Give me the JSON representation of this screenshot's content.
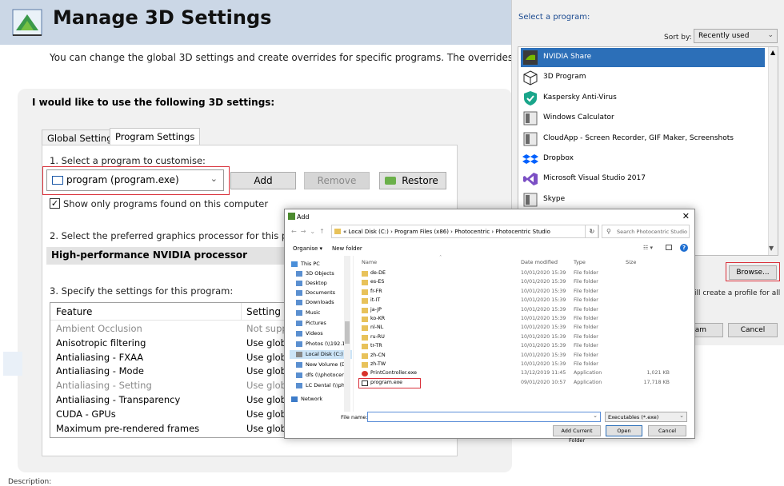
{
  "header": {
    "title": "Manage 3D Settings"
  },
  "intro": "You can change the global 3D settings and create overrides for specific programs. The overrides will be usec",
  "settings_heading": "I would like to use the following 3D settings:",
  "tabs": [
    {
      "label": "Global Settings"
    },
    {
      "label": "Program Settings"
    }
  ],
  "step1": {
    "label": "1. Select a program to customise:",
    "selected_program": "program (program.exe)",
    "add": "Add",
    "remove": "Remove",
    "restore": "Restore",
    "show_only": "Show only programs found on this computer",
    "show_only_checked": true
  },
  "step2": {
    "label": "2. Select the preferred graphics processor for this progra",
    "value": "High-performance NVIDIA processor"
  },
  "step3": {
    "label": "3. Specify the settings for this program:",
    "columns": [
      "Feature",
      "Setting"
    ],
    "rows": [
      {
        "feature": "Ambient Occlusion",
        "setting": "Not suppo",
        "dim": true
      },
      {
        "feature": "Anisotropic filtering",
        "setting": "Use globa",
        "dim": false
      },
      {
        "feature": "Antialiasing - FXAA",
        "setting": "Use globa",
        "dim": false
      },
      {
        "feature": "Antialiasing - Mode",
        "setting": "Use globa",
        "dim": false
      },
      {
        "feature": "Antialiasing - Setting",
        "setting": "Use globa",
        "dim": true
      },
      {
        "feature": "Antialiasing - Transparency",
        "setting": "Use globa",
        "dim": false
      },
      {
        "feature": "CUDA - GPUs",
        "setting": "Use globa",
        "dim": false
      },
      {
        "feature": "Maximum pre-rendered frames",
        "setting": "Use globa",
        "dim": false
      }
    ]
  },
  "description_label": "Description:",
  "program_window": {
    "heading": "Select a program:",
    "sort_by_label": "Sort by:",
    "sort_by_value": "Recently used",
    "programs": [
      {
        "name": "NVIDIA Share",
        "icon": "nvidia-icon",
        "selected": true
      },
      {
        "name": "3D Program",
        "icon": "cube-icon",
        "selected": false
      },
      {
        "name": "Kaspersky Anti-Virus",
        "icon": "shield-icon",
        "selected": false
      },
      {
        "name": "Windows Calculator",
        "icon": "app-icon",
        "selected": false
      },
      {
        "name": "CloudApp - Screen Recorder, GIF Maker, Screenshots",
        "icon": "app-icon",
        "selected": false
      },
      {
        "name": "Dropbox",
        "icon": "dropbox-icon",
        "selected": false
      },
      {
        "name": "Microsoft Visual Studio 2017",
        "icon": "visual-studio-icon",
        "selected": false
      },
      {
        "name": "Skype",
        "icon": "app-icon",
        "selected": false
      }
    ],
    "browse": "Browse...",
    "profile_note": "ill create a profile for all",
    "add_program": "ram",
    "cancel": "Cancel"
  },
  "add_dialog": {
    "title": "Add",
    "path": "« Local Disk (C:) › Program Files (x86) › Photocentric › Photocentric Studio",
    "search_placeholder": "Search Photocentric Studio",
    "organise": "Organise ▾",
    "new_folder": "New folder",
    "tree": [
      {
        "name": "This PC",
        "selected": false
      },
      {
        "name": "3D Objects",
        "selected": false
      },
      {
        "name": "Desktop",
        "selected": false
      },
      {
        "name": "Documents",
        "selected": false
      },
      {
        "name": "Downloads",
        "selected": false
      },
      {
        "name": "Music",
        "selected": false
      },
      {
        "name": "Pictures",
        "selected": false
      },
      {
        "name": "Videos",
        "selected": false
      },
      {
        "name": "Photos (\\\\192.16",
        "selected": false
      },
      {
        "name": "Local Disk (C:)",
        "selected": true
      },
      {
        "name": "New Volume (D:",
        "selected": false
      },
      {
        "name": "dfs (\\\\photocent",
        "selected": false
      },
      {
        "name": "LC Dental (\\\\phc",
        "selected": false
      },
      {
        "name": "Network",
        "selected": false
      }
    ],
    "columns": [
      "Name",
      "Date modified",
      "Type",
      "Size"
    ],
    "files": [
      {
        "name": "de-DE",
        "date": "10/01/2020 15:39",
        "type": "File folder",
        "size": ""
      },
      {
        "name": "es-ES",
        "date": "10/01/2020 15:39",
        "type": "File folder",
        "size": ""
      },
      {
        "name": "fr-FR",
        "date": "10/01/2020 15:39",
        "type": "File folder",
        "size": ""
      },
      {
        "name": "it-IT",
        "date": "10/01/2020 15:39",
        "type": "File folder",
        "size": ""
      },
      {
        "name": "ja-JP",
        "date": "10/01/2020 15:39",
        "type": "File folder",
        "size": ""
      },
      {
        "name": "ko-KR",
        "date": "10/01/2020 15:39",
        "type": "File folder",
        "size": ""
      },
      {
        "name": "nl-NL",
        "date": "10/01/2020 15:39",
        "type": "File folder",
        "size": ""
      },
      {
        "name": "ru-RU",
        "date": "10/01/2020 15:39",
        "type": "File folder",
        "size": ""
      },
      {
        "name": "tr-TR",
        "date": "10/01/2020 15:39",
        "type": "File folder",
        "size": ""
      },
      {
        "name": "zh-CN",
        "date": "10/01/2020 15:39",
        "type": "File folder",
        "size": ""
      },
      {
        "name": "zh-TW",
        "date": "10/01/2020 15:39",
        "type": "File folder",
        "size": ""
      },
      {
        "name": "PrintController.exe",
        "date": "13/12/2019 11:45",
        "type": "Application",
        "size": "1,021 KB"
      },
      {
        "name": "program.exe",
        "date": "09/01/2020 10:57",
        "type": "Application",
        "size": "17,718 KB"
      }
    ],
    "file_name_label": "File name:",
    "file_name_value": "",
    "file_type": "Executables (*.exe)",
    "add_current_folder": "Add Current Folder",
    "open": "Open",
    "cancel": "Cancel"
  }
}
